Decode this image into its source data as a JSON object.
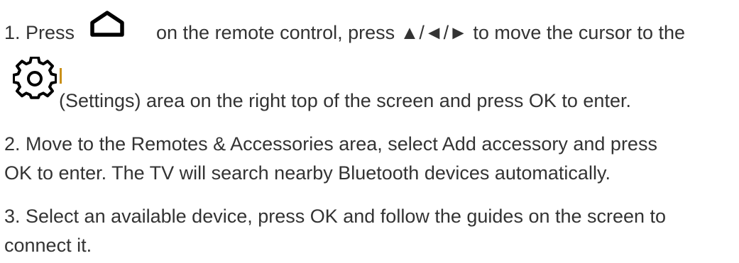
{
  "doc": {
    "step1": {
      "prefix": "1. Press",
      "middle": "on the remote control, press ▲/◄/► to move the cursor to the",
      "settings_line": "(Settings) area on the right top of the screen and press OK to enter.",
      "home_icon": "home-icon",
      "settings_icon": "gear-icon"
    },
    "step2": {
      "line1": "2. Move to the Remotes & Accessories area, select Add accessory and press",
      "line2": "OK to enter. The TV will search nearby Bluetooth devices automatically."
    },
    "step3": {
      "line1": "3. Select an available device, press OK and follow the guides on the screen to",
      "line2": "connect it."
    },
    "colors": {
      "text": "#333333",
      "icon": "#000000",
      "gear_accent": "#c9901a"
    }
  }
}
